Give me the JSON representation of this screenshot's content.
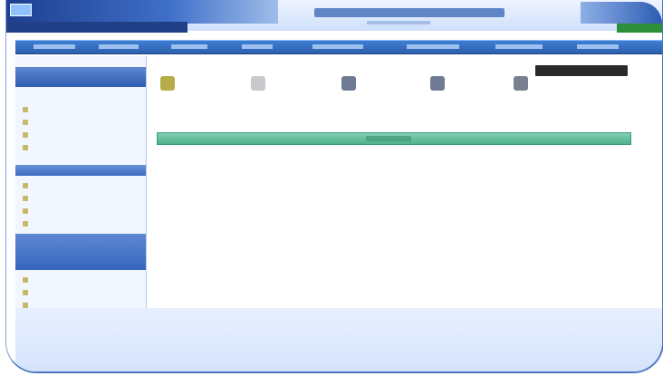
{
  "header": {
    "app_title": "",
    "top_nav": [
      ""
    ],
    "right_button": ""
  },
  "menu": {
    "items": []
  },
  "sidebar": {
    "header": "",
    "sections": [
      {
        "title": ""
      },
      {
        "title": ""
      }
    ],
    "items_group_1": [],
    "items_group_2": [],
    "highlighted_rows": [],
    "items_group_3": []
  },
  "quick_links": [
    {
      "label": ""
    },
    {
      "label": ""
    },
    {
      "label": ""
    },
    {
      "label": ""
    },
    {
      "label": ""
    }
  ],
  "auth": {
    "signin": "",
    "signout": ""
  },
  "content": {
    "page_label": "",
    "page_right": "",
    "green_bar": "",
    "empty_note": ""
  },
  "colors": {
    "brand_dark": "#1f3f86",
    "brand_mid": "#2b5fae",
    "accent_green": "#4fb08b",
    "panel_bg": "#f2f6ff"
  },
  "icons": [
    "logo-icon",
    "home-icon",
    "document-icon",
    "calendar-icon",
    "report-icon",
    "settings-icon"
  ]
}
